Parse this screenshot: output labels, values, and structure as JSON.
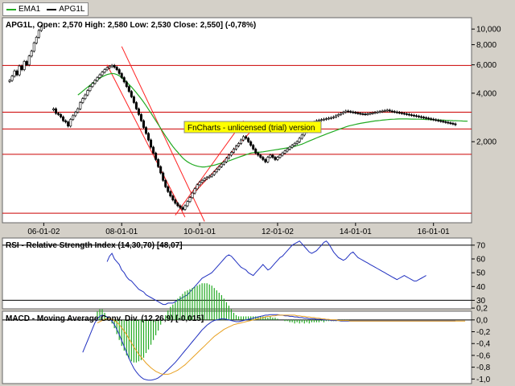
{
  "legend": [
    {
      "label": "EMA1",
      "color": "#22aa22"
    },
    {
      "label": "APG1L",
      "color": "#000000"
    }
  ],
  "watermark": "FnCharts - unlicensed (trial) version",
  "chart_data": [
    {
      "type": "candlestick",
      "title": "APG1L, Open: 2,570  High: 2,580  Low: 2,530  Close: 2,550] (-0,78%)",
      "y_scale": "log",
      "ylim": [
        650,
        11500
      ],
      "y_ticks": [
        "10,000",
        "8,000",
        "6,000",
        "4,000",
        "2,000"
      ],
      "y_tick_values": [
        10000,
        8000,
        6000,
        4000,
        2000
      ],
      "x_ticks": [
        "06-01-02",
        "08-01-01",
        "10-01-01",
        "12-01-02",
        "14-01-01",
        "16-01-01"
      ],
      "x_tick_index": [
        14,
        46,
        78,
        110,
        142,
        174
      ],
      "x_count": 186,
      "close": [
        4800,
        5100,
        5500,
        5200,
        5900,
        5600,
        6300,
        6000,
        6800,
        7300,
        8200,
        8900,
        9800,
        10400,
        null,
        null,
        null,
        null,
        3200,
        3000,
        2950,
        2850,
        2700,
        2650,
        2500,
        2750,
        2900,
        3050,
        3200,
        3500,
        3700,
        3900,
        4150,
        4400,
        4600,
        4800,
        5000,
        5200,
        5400,
        5600,
        5750,
        5850,
        5950,
        5800,
        5600,
        5300,
        5000,
        4700,
        4400,
        4100,
        3800,
        3500,
        3200,
        2950,
        2700,
        2450,
        2250,
        2050,
        1850,
        1700,
        1550,
        1400,
        1280,
        1150,
        1050,
        980,
        920,
        870,
        830,
        800,
        780,
        760,
        800,
        850,
        900,
        960,
        1020,
        1080,
        1120,
        1150,
        1180,
        1200,
        1220,
        1250,
        1300,
        1350,
        1400,
        1450,
        1500,
        1580,
        1650,
        1720,
        1800,
        1880,
        1950,
        2050,
        2150,
        2100,
        2000,
        1900,
        1800,
        1700,
        1650,
        1600,
        1550,
        1500,
        1600,
        1650,
        1600,
        1550,
        1600,
        1650,
        1700,
        1750,
        1800,
        1850,
        1900,
        1950,
        2000,
        2100,
        2200,
        2300,
        2400,
        2500,
        2600,
        2650,
        2700,
        2720,
        2740,
        2760,
        2780,
        2800,
        2820,
        2850,
        2900,
        2950,
        3000,
        3050,
        3100,
        3080,
        3060,
        3040,
        3020,
        3000,
        2980,
        2970,
        2960,
        2980,
        3000,
        3020,
        3040,
        3060,
        3080,
        3100,
        3120,
        3140,
        3100,
        3080,
        3060,
        3040,
        3020,
        3000,
        2980,
        2960,
        2940,
        2920,
        2900,
        2880,
        2860,
        2840,
        2820,
        2800,
        2780,
        2760,
        2740,
        2720,
        2700,
        2680,
        2660,
        2640,
        2620,
        2600,
        2580,
        2550
      ],
      "ema": [
        null,
        null,
        null,
        null,
        null,
        null,
        null,
        null,
        null,
        null,
        null,
        null,
        null,
        null,
        null,
        null,
        null,
        null,
        null,
        null,
        null,
        null,
        null,
        null,
        null,
        null,
        null,
        null,
        3900,
        4000,
        4120,
        4240,
        4360,
        4480,
        4600,
        4720,
        4840,
        4950,
        5060,
        5150,
        5220,
        5270,
        5300,
        5280,
        5220,
        5130,
        5000,
        4850,
        4690,
        4530,
        4370,
        4200,
        4030,
        3860,
        3690,
        3520,
        3350,
        3180,
        3010,
        2850,
        2700,
        2560,
        2420,
        2290,
        2170,
        2060,
        1960,
        1870,
        1790,
        1720,
        1650,
        1590,
        1540,
        1500,
        1470,
        1445,
        1425,
        1410,
        1400,
        1395,
        1395,
        1400,
        1410,
        1420,
        1430,
        1445,
        1460,
        1475,
        1490,
        1505,
        1520,
        1540,
        1560,
        1580,
        1600,
        1620,
        1640,
        1660,
        1680,
        1700,
        1710,
        1715,
        1720,
        1725,
        1730,
        1740,
        1750,
        1760,
        1770,
        1780,
        1790,
        1800,
        1810,
        1820,
        1830,
        1840,
        1850,
        1870,
        1890,
        1910,
        1930,
        1960,
        1990,
        2020,
        2050,
        2080,
        2110,
        2140,
        2170,
        2200,
        2230,
        2260,
        2290,
        2320,
        2350,
        2380,
        2410,
        2440,
        2470,
        2500,
        2520,
        2540,
        2560,
        2580,
        2600,
        2615,
        2630,
        2645,
        2660,
        2675,
        2690,
        2700,
        2710,
        2720,
        2730,
        2740,
        2750,
        2755,
        2760,
        2765,
        2770,
        2770,
        2770,
        2768,
        2766,
        2764,
        2762,
        2760,
        2758,
        2756,
        2752,
        2748,
        2744,
        2740,
        2736,
        2732,
        2728,
        2724,
        2720,
        2716,
        2712,
        2708,
        2704,
        2700,
        2696,
        2692,
        2688,
        2684,
        2680
      ],
      "horizontal_levels": [
        5950,
        3050,
        2400,
        1670,
        720
      ],
      "trend_lines": [
        {
          "from": [
            40,
            6000
          ],
          "to": [
            72,
            680
          ]
        },
        {
          "from": [
            46,
            7800
          ],
          "to": [
            80,
            640
          ]
        },
        {
          "from": [
            68,
            700
          ],
          "to": [
            96,
            2700
          ]
        },
        {
          "from": [
            74,
            900
          ],
          "to": [
            101,
            2500
          ]
        }
      ]
    },
    {
      "type": "line",
      "title": "RSI - Relative Strength Index (14,30,70) [48,07]",
      "ylim": [
        25,
        74
      ],
      "y_ticks": [
        "70",
        "60",
        "50",
        "40",
        "30"
      ],
      "y_tick_values": [
        70,
        60,
        50,
        40,
        30
      ],
      "levels": [
        70,
        30
      ],
      "series": [
        {
          "color": "#2030c0",
          "values": [
            null,
            null,
            null,
            null,
            null,
            null,
            null,
            null,
            null,
            null,
            null,
            null,
            null,
            null,
            null,
            null,
            null,
            null,
            null,
            null,
            null,
            null,
            null,
            null,
            null,
            null,
            null,
            null,
            null,
            null,
            null,
            null,
            null,
            null,
            null,
            null,
            null,
            null,
            null,
            null,
            58,
            62,
            64,
            60,
            58,
            56,
            52,
            50,
            47,
            45,
            44,
            42,
            40,
            38,
            37,
            36,
            34,
            33,
            32,
            31,
            30,
            29,
            28,
            27,
            27,
            28,
            28,
            28,
            29,
            30,
            31,
            32,
            33,
            34,
            36,
            38,
            40,
            42,
            44,
            46,
            47,
            48,
            49,
            50,
            52,
            54,
            56,
            58,
            60,
            62,
            63,
            62,
            60,
            58,
            56,
            54,
            53,
            52,
            50,
            49,
            48,
            50,
            52,
            54,
            56,
            54,
            52,
            53,
            55,
            57,
            59,
            61,
            62,
            64,
            66,
            68,
            70,
            71,
            72,
            73,
            71,
            69,
            67,
            65,
            64,
            65,
            66,
            68,
            70,
            72,
            73,
            71,
            68,
            65,
            63,
            61,
            60,
            59,
            60,
            62,
            64,
            65,
            63,
            61,
            60,
            59,
            58,
            57,
            56,
            55,
            54,
            53,
            52,
            51,
            50,
            49,
            48,
            47,
            46,
            45,
            46,
            47,
            48,
            47,
            46,
            45,
            44,
            44,
            45,
            46,
            47,
            48
          ]
        }
      ]
    },
    {
      "type": "line",
      "title": "MACD - Moving Average Conv. Div. (12,26,9) [-0,015]",
      "ylim": [
        -1.05,
        0.12
      ],
      "y_ticks": [
        "0,2",
        "0,0",
        "-0,2",
        "-0,4",
        "-0,6",
        "-0,8",
        "-1,0"
      ],
      "y_tick_values": [
        0.2,
        0.0,
        -0.2,
        -0.4,
        -0.6,
        -0.8,
        -1.0
      ],
      "series": [
        {
          "name": "MACD",
          "color": "#2030c0",
          "values": [
            null,
            null,
            null,
            null,
            null,
            null,
            null,
            null,
            null,
            null,
            null,
            null,
            null,
            null,
            null,
            null,
            null,
            null,
            null,
            null,
            null,
            null,
            null,
            null,
            null,
            null,
            null,
            null,
            null,
            null,
            -0.55,
            -0.45,
            -0.35,
            -0.25,
            -0.15,
            -0.05,
            0.02,
            0.06,
            0.08,
            0.07,
            0.05,
            0.02,
            -0.02,
            -0.08,
            -0.16,
            -0.25,
            -0.35,
            -0.45,
            -0.55,
            -0.65,
            -0.74,
            -0.82,
            -0.88,
            -0.93,
            -0.97,
            -1.0,
            -1.01,
            -1.02,
            -1.02,
            -1.01,
            -1.0,
            -0.98,
            -0.95,
            -0.92,
            -0.88,
            -0.84,
            -0.8,
            -0.76,
            -0.72,
            -0.67,
            -0.62,
            -0.57,
            -0.52,
            -0.47,
            -0.42,
            -0.37,
            -0.32,
            -0.27,
            -0.22,
            -0.17,
            -0.13,
            -0.09,
            -0.06,
            -0.03,
            -0.01,
            0.0,
            0.01,
            0.02,
            0.02,
            0.01,
            0.0,
            -0.01,
            -0.02,
            -0.03,
            -0.03,
            -0.02,
            -0.01,
            0.0,
            0.01,
            0.02,
            0.03,
            0.04,
            0.05,
            0.06,
            0.07,
            0.08,
            0.08,
            0.09,
            0.09,
            0.09,
            0.09,
            0.08,
            0.08,
            0.07,
            0.07,
            0.06,
            0.06,
            0.05,
            0.05,
            0.04,
            0.04,
            0.03,
            0.03,
            0.02,
            0.02,
            0.02,
            0.01,
            0.01,
            0.01,
            0.0,
            0.0,
            0.0,
            -0.01,
            -0.01,
            -0.01,
            -0.01,
            -0.02,
            -0.02,
            -0.02,
            -0.02,
            -0.02,
            -0.02,
            -0.02,
            -0.02,
            -0.02,
            -0.02,
            -0.02,
            -0.02,
            -0.02,
            -0.02,
            -0.02,
            -0.02,
            -0.02,
            -0.02,
            -0.02,
            -0.02,
            -0.02,
            -0.02,
            -0.02,
            -0.02,
            -0.02,
            -0.02,
            -0.02,
            -0.02,
            -0.02,
            -0.02,
            -0.02,
            -0.02,
            -0.02,
            -0.02,
            -0.02,
            -0.02,
            -0.02,
            -0.02,
            -0.02,
            -0.02,
            -0.02,
            -0.02,
            -0.02,
            -0.02,
            -0.02,
            -0.02,
            -0.02,
            -0.02
          ]
        },
        {
          "name": "Signal",
          "color": "#e8a020",
          "values": [
            null,
            null,
            null,
            null,
            null,
            null,
            null,
            null,
            null,
            null,
            null,
            null,
            null,
            null,
            null,
            null,
            null,
            null,
            null,
            null,
            null,
            null,
            null,
            null,
            null,
            null,
            null,
            null,
            null,
            null,
            null,
            null,
            null,
            null,
            null,
            null,
            -0.05,
            -0.03,
            -0.01,
            0.01,
            0.02,
            0.02,
            0.01,
            -0.01,
            -0.04,
            -0.08,
            -0.13,
            -0.19,
            -0.25,
            -0.32,
            -0.39,
            -0.46,
            -0.52,
            -0.58,
            -0.63,
            -0.68,
            -0.73,
            -0.77,
            -0.81,
            -0.84,
            -0.87,
            -0.89,
            -0.91,
            -0.92,
            -0.92,
            -0.92,
            -0.91,
            -0.89,
            -0.87,
            -0.85,
            -0.82,
            -0.79,
            -0.76,
            -0.72,
            -0.68,
            -0.64,
            -0.6,
            -0.56,
            -0.52,
            -0.48,
            -0.44,
            -0.4,
            -0.36,
            -0.32,
            -0.28,
            -0.25,
            -0.22,
            -0.19,
            -0.16,
            -0.14,
            -0.12,
            -0.1,
            -0.08,
            -0.07,
            -0.06,
            -0.05,
            -0.04,
            -0.03,
            -0.02,
            -0.01,
            0.0,
            0.01,
            0.02,
            0.03,
            0.04,
            0.05,
            0.06,
            0.06,
            0.07,
            0.07,
            0.08,
            0.08,
            0.08,
            0.08,
            0.08,
            0.08,
            0.08,
            0.08,
            0.07,
            0.07,
            0.06,
            0.06,
            0.05,
            0.05,
            0.04,
            0.04,
            0.03,
            0.03,
            0.02,
            0.02,
            0.01,
            0.01,
            0.0,
            0.0,
            0.0,
            -0.01,
            -0.01,
            -0.01,
            -0.01,
            -0.01,
            -0.02,
            -0.02,
            -0.02,
            -0.02,
            -0.02,
            -0.02,
            -0.02,
            -0.02,
            -0.02,
            -0.02,
            -0.02,
            -0.02,
            -0.02,
            -0.02,
            -0.02,
            -0.02,
            -0.02,
            -0.02,
            -0.02,
            -0.02,
            -0.02,
            -0.02,
            -0.02,
            -0.02,
            -0.02,
            -0.02,
            -0.02,
            -0.02,
            -0.02,
            -0.02,
            -0.02,
            -0.02,
            -0.02,
            -0.02,
            -0.02,
            -0.02,
            -0.02,
            -0.02,
            -0.02,
            -0.02,
            -0.02,
            -0.02,
            -0.02,
            -0.02,
            -0.02,
            -0.02,
            -0.02,
            -0.02
          ]
        }
      ]
    }
  ]
}
